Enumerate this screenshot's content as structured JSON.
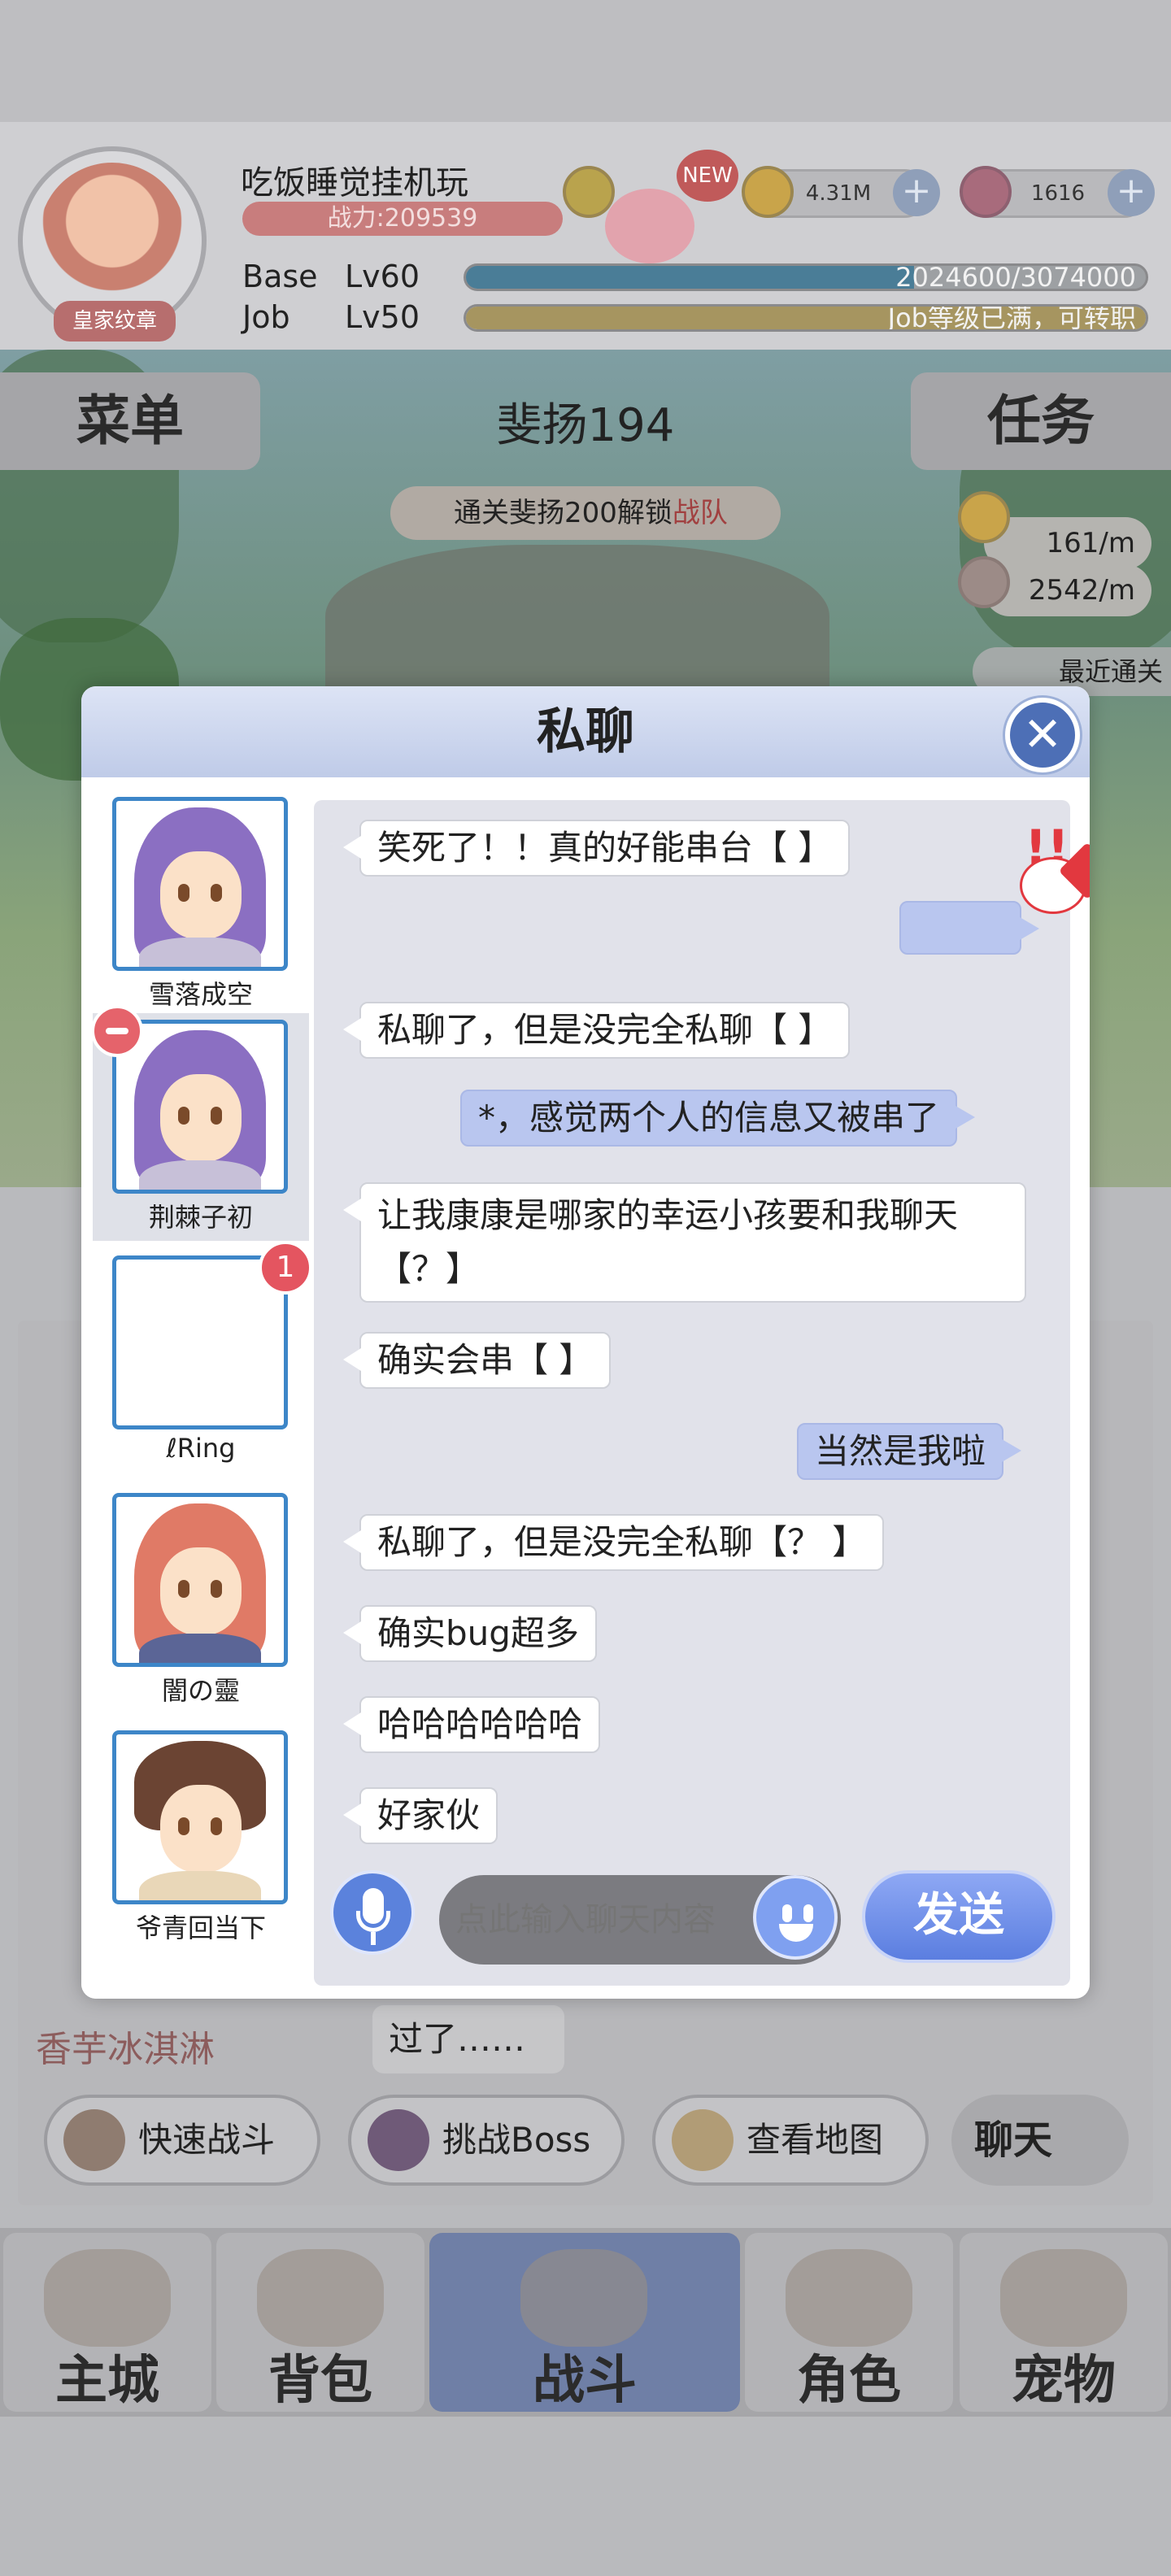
{
  "player": {
    "name": "吃饭睡觉挂机玩",
    "power": "战力:209539",
    "badge": "皇家纹章",
    "base_label": "Base",
    "base_level": "Lv60",
    "base_exp": "2024600/3074000",
    "base_exp_fraction": 0.659,
    "job_label": "Job",
    "job_level": "Lv50",
    "job_exp": "Job等级已满，可转职",
    "job_exp_fraction": 1.0
  },
  "currencies": {
    "new_badge": "NEW",
    "zeny": "4.31M",
    "gems": "1616",
    "plus": "+"
  },
  "stage": {
    "menu": "菜单",
    "title": "斐扬194",
    "tasks": "任务",
    "unlock_text": "通关斐扬200解锁",
    "unlock_red": "战队",
    "zeny_rate": "161/m",
    "exp_rate": "2542/m",
    "recent": "最近通关"
  },
  "lower_panel": {
    "log_sender": "香芋冰淇淋",
    "reply": "过了……",
    "buttons": [
      "快速战斗",
      "挑战Boss",
      "查看地图"
    ],
    "chat_toggle": "聊天"
  },
  "nav": [
    "主城",
    "背包",
    "战斗",
    "角色",
    "宠物"
  ],
  "dialog": {
    "title": "私聊",
    "close": "✕",
    "contacts": [
      {
        "name": "雪落成空"
      },
      {
        "name": "荆棘子初"
      },
      {
        "name": "ℓRing",
        "unread": "1"
      },
      {
        "name": "闇の靈"
      },
      {
        "name": "爷青回当下"
      }
    ],
    "messages": [
      {
        "side": "recv",
        "text": "笑死了！！真的好能串台【 】"
      },
      {
        "side": "sent",
        "text": ""
      },
      {
        "side": "recv",
        "text": "私聊了，但是没完全私聊【 】"
      },
      {
        "side": "sent",
        "text": "*，感觉两个人的信息又被串了"
      },
      {
        "side": "recv",
        "text": "让我康康是哪家的幸运小孩要和我聊天【？】"
      },
      {
        "side": "recv",
        "text": "确实会串【 】"
      },
      {
        "side": "sent",
        "text": "当然是我啦"
      },
      {
        "side": "recv",
        "text": "私聊了，但是没完全私聊【？ 】"
      },
      {
        "side": "recv",
        "text": "确实bug超多"
      },
      {
        "side": "recv",
        "text": "哈哈哈哈哈哈"
      },
      {
        "side": "recv",
        "text": "好家伙"
      }
    ],
    "input_placeholder": "点此输入聊天内容",
    "send": "发送"
  }
}
